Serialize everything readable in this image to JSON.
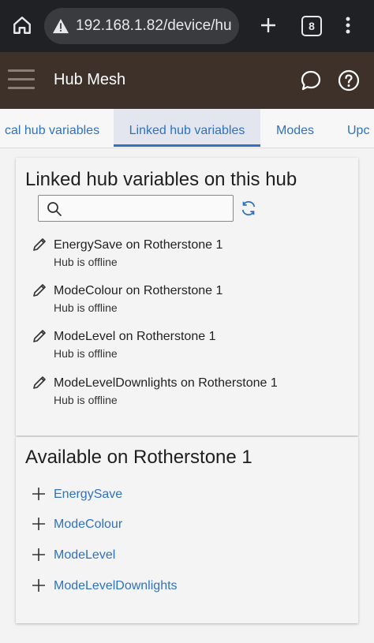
{
  "browser": {
    "url": "192.168.1.82/device/hu",
    "tab_count": "8"
  },
  "appbar": {
    "title": "Hub Mesh"
  },
  "tabs": [
    {
      "label": "cal hub variables",
      "active": false
    },
    {
      "label": "Linked hub variables",
      "active": true
    },
    {
      "label": "Modes",
      "active": false
    },
    {
      "label": "Upc",
      "active": false
    }
  ],
  "linked": {
    "title": "Linked hub variables on this hub",
    "search_placeholder": "",
    "items": [
      {
        "name": "EnergySave on Rotherstone 1",
        "status": "Hub is offline"
      },
      {
        "name": "ModeColour on Rotherstone 1",
        "status": "Hub is offline"
      },
      {
        "name": "ModeLevel on Rotherstone 1",
        "status": "Hub is offline"
      },
      {
        "name": "ModeLevelDownlights on Rotherstone 1",
        "status": "Hub is offline"
      }
    ]
  },
  "available": {
    "title": "Available on Rotherstone 1",
    "items": [
      {
        "label": "EnergySave"
      },
      {
        "label": "ModeColour"
      },
      {
        "label": "ModeLevel"
      },
      {
        "label": "ModeLevelDownlights"
      }
    ]
  },
  "colors": {
    "link": "#2e72c0",
    "appbar": "#3e3129",
    "browserbar": "#1f2125"
  }
}
